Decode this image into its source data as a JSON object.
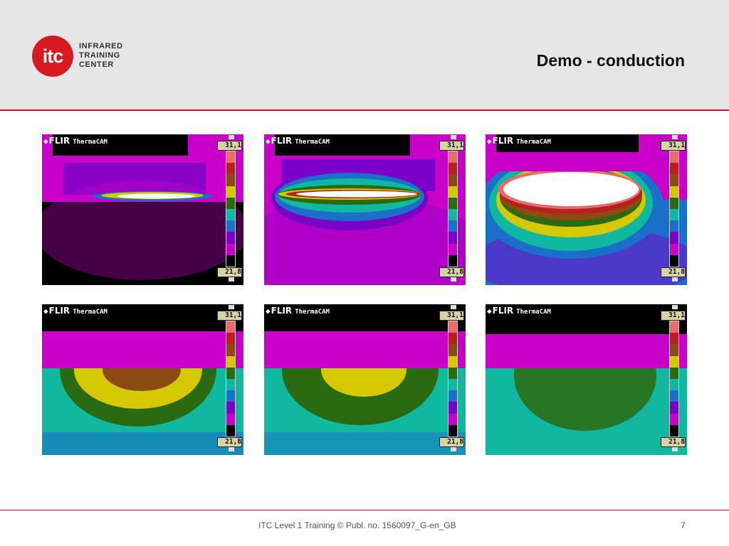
{
  "header": {
    "logo_mark": "itc",
    "logo_lines": [
      "INFRARED",
      "TRAINING",
      "CENTER"
    ],
    "title": "Demo - conduction"
  },
  "thermograms": [
    {
      "brand": "FLIR",
      "model": "ThermaCAM",
      "max": "31,1",
      "min": "21,8"
    },
    {
      "brand": "FLIR",
      "model": "ThermaCAM",
      "max": "31,1",
      "min": "21,8"
    },
    {
      "brand": "FLIR",
      "model": "ThermaCAM",
      "max": "31,1",
      "min": "21,8"
    },
    {
      "brand": "FLIR",
      "model": "ThermaCAM",
      "max": "31,1",
      "min": "21,8"
    },
    {
      "brand": "FLIR",
      "model": "ThermaCAM",
      "max": "31,1",
      "min": "21,8"
    },
    {
      "brand": "FLIR",
      "model": "ThermaCAM",
      "max": "31,1",
      "min": "21,8"
    }
  ],
  "palette": [
    "#e86b6b",
    "#b82020",
    "#8b4a10",
    "#d4c800",
    "#2a6a10",
    "#10b8a0",
    "#1a70c8",
    "#7a00c8",
    "#c800c8",
    "#000000"
  ],
  "footer": {
    "text": "ITC Level 1 Training ©  Publ. no. 1560097_G-en_GB",
    "page": "7"
  }
}
